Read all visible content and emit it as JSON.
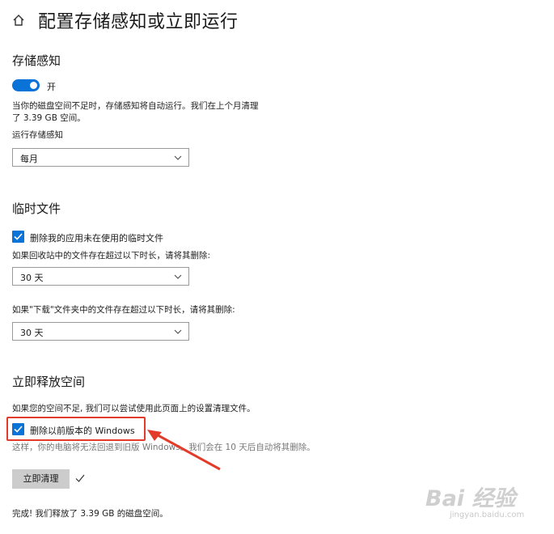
{
  "header": {
    "title": "配置存储感知或立即运行",
    "home_icon": "home-icon"
  },
  "storage_sense": {
    "title": "存储感知",
    "toggle_state": "开",
    "toggle_on": true,
    "description_line1": "当你的磁盘空间不足时，存储感知将自动运行。我们在上个月清理",
    "description_line2": "了 3.39 GB 空间。",
    "run_label": "运行存储感知",
    "run_value": "每月"
  },
  "temp_files": {
    "title": "临时文件",
    "delete_unused_label": "删除我的应用未在使用的临时文件",
    "delete_unused_checked": true,
    "recycle_label": "如果回收站中的文件存在超过以下时长，请将其删除:",
    "recycle_value": "30 天",
    "downloads_label": "如果\"下载\"文件夹中的文件存在超过以下时长，请将其删除:",
    "downloads_value": "30 天"
  },
  "free_now": {
    "title": "立即释放空间",
    "description": "如果您的空间不足, 我们可以尝试使用此页面上的设置清理文件。",
    "delete_previous_windows_label": "删除以前版本的 Windows",
    "delete_previous_windows_checked": true,
    "note": "这样，你的电脑将无法回退到旧版 Windows。我们会在 10 天后自动将其删除。",
    "clean_button_label": "立即清理",
    "result_text": "完成! 我们释放了 3.39 GB 的磁盘空间。"
  },
  "watermark": {
    "logo_text": "Bai 经验",
    "url": "jingyan.baidu.com"
  },
  "colors": {
    "accent": "#0a73d8",
    "highlight": "#e33b2a",
    "button_bg": "#cccccc"
  }
}
